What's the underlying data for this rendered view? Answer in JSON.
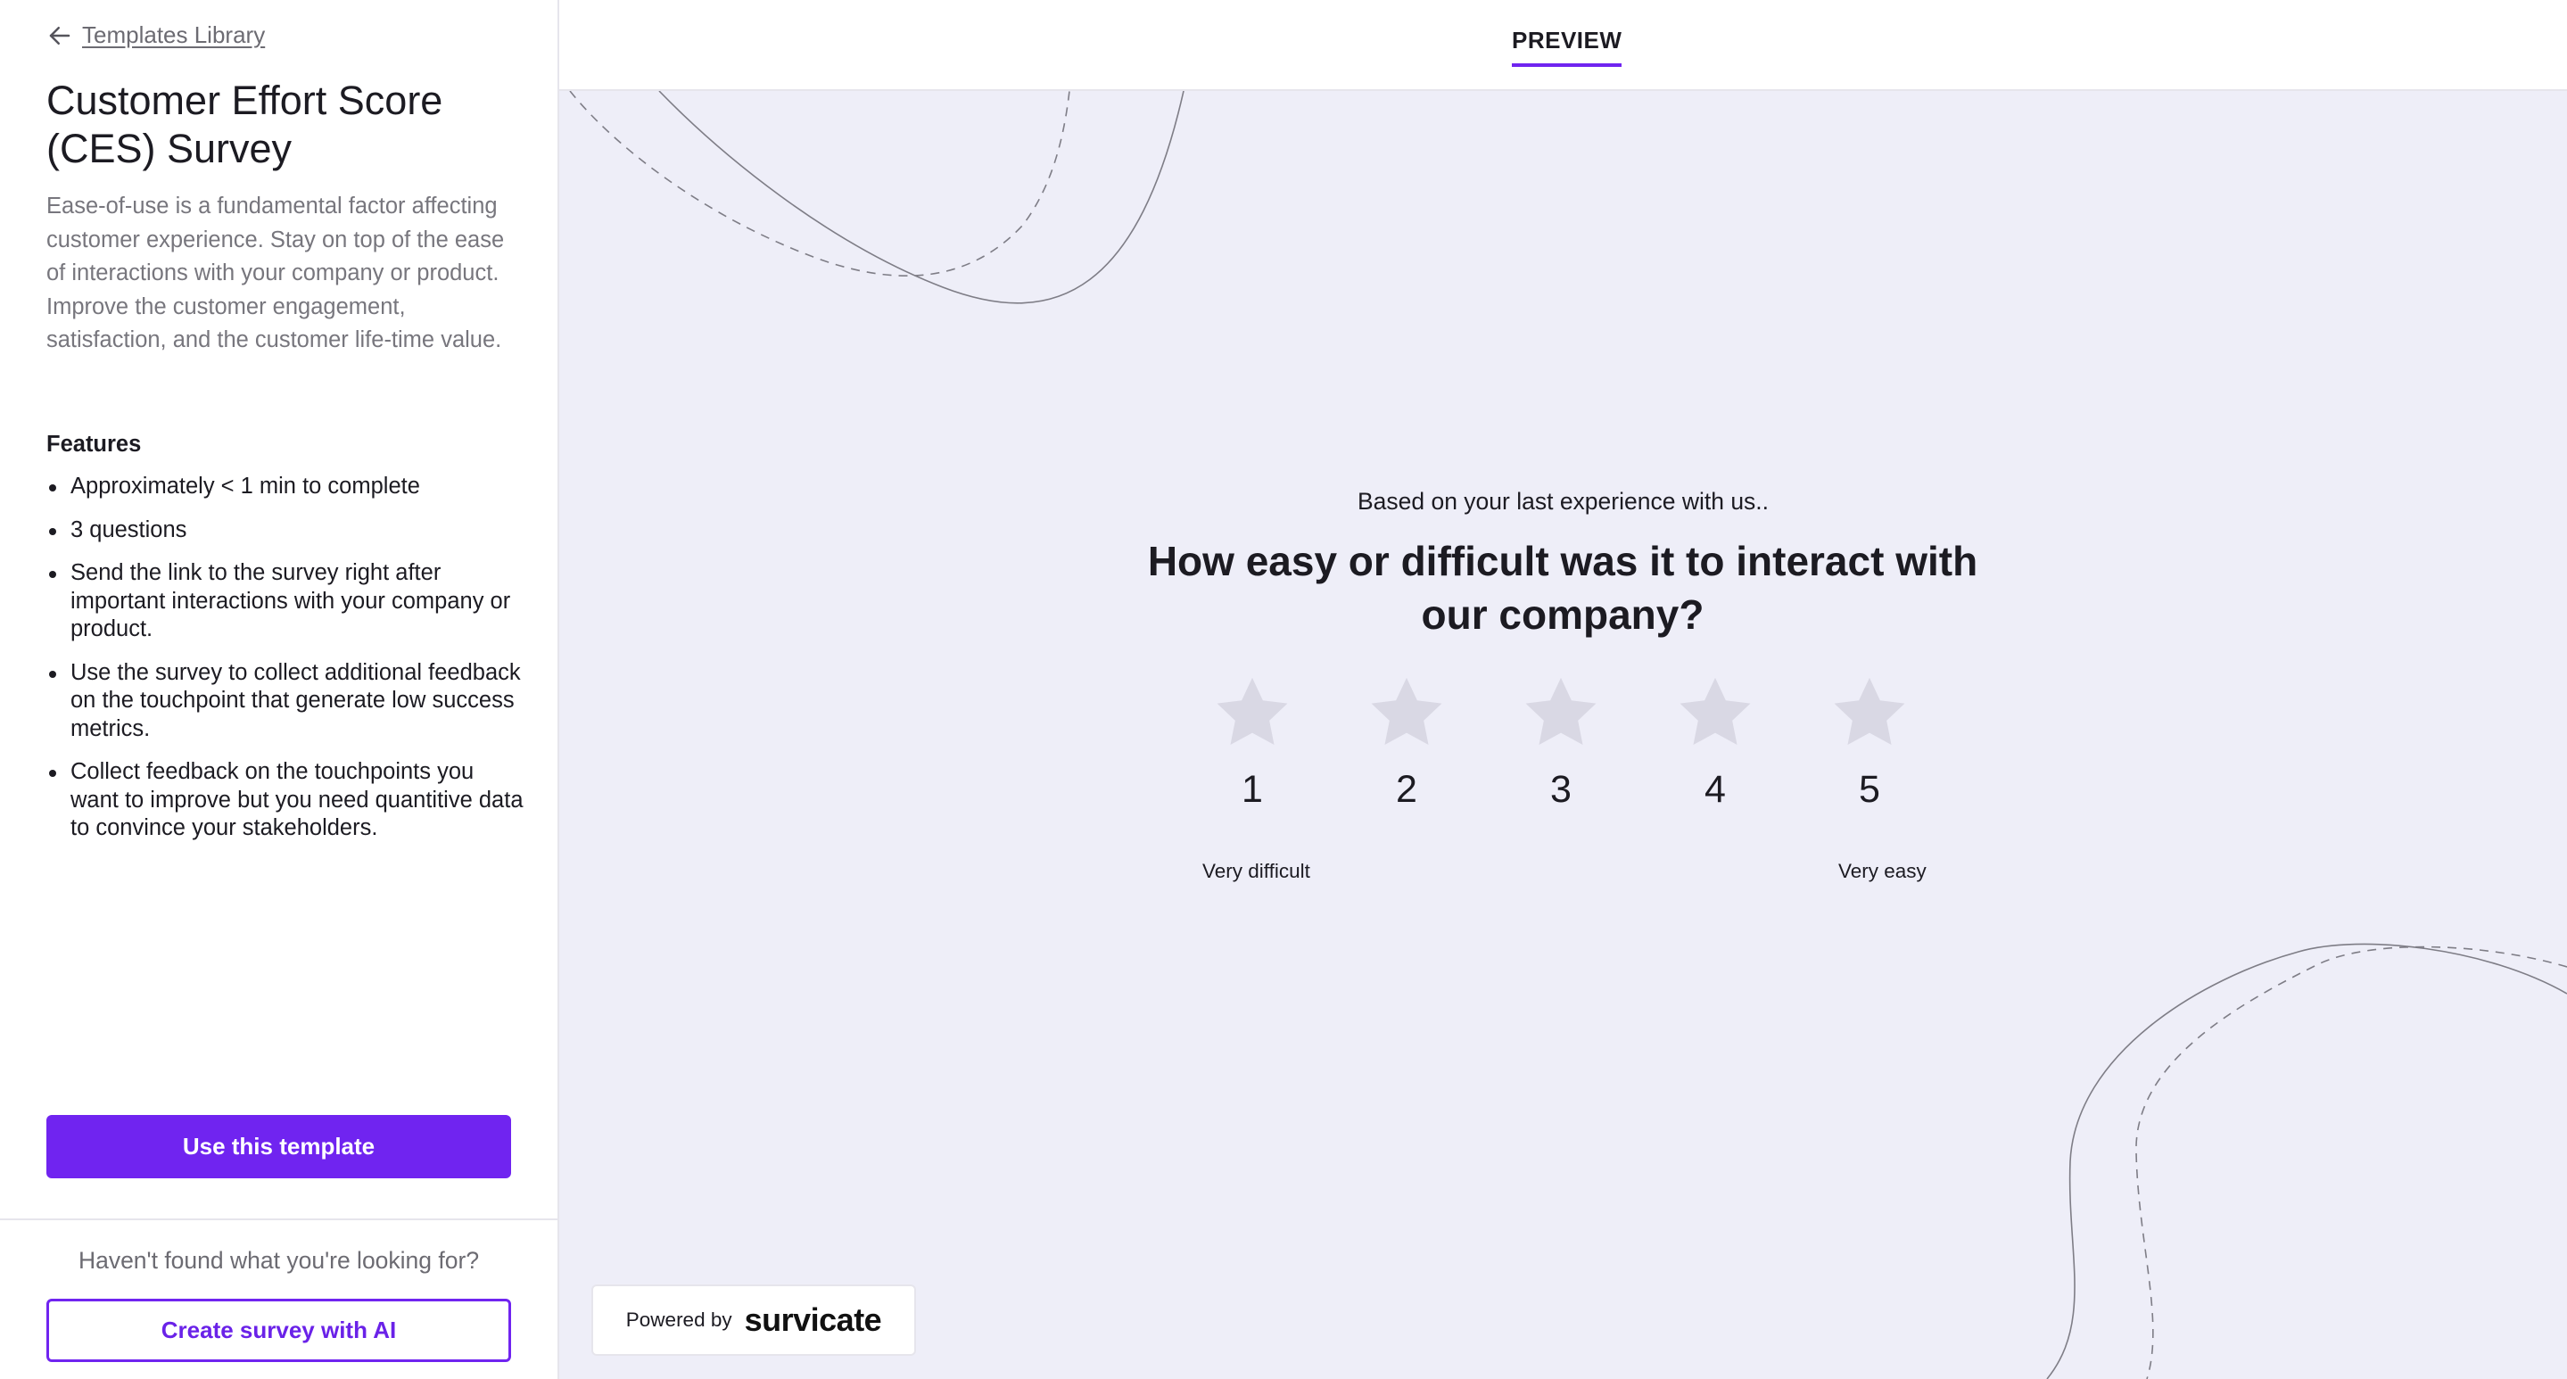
{
  "sidebar": {
    "back_link": "Templates Library",
    "title": "Customer Effort Score (CES) Survey",
    "description": "Ease-of-use is a fundamental factor affecting customer experience. Stay on top of the ease of interactions with your company or product. Improve the customer engagement, satisfaction, and the customer life-time value.",
    "features_heading": "Features",
    "features": [
      "Approximately < 1 min to complete",
      "3 questions",
      "Send the link to the survey right after important interactions with your company or product.",
      "Use the survey to collect additional feedback on the touchpoint that generate low success metrics.",
      "Collect feedback on the touchpoints you want to improve but you need quantitive data to convince your stakeholders."
    ],
    "use_template_button": "Use this template",
    "footer_text": "Haven't found what you're looking for?",
    "create_ai_button": "Create survey with AI"
  },
  "header": {
    "tab": "PREVIEW"
  },
  "survey": {
    "intro": "Based on your last experience with us..",
    "question": "How easy or difficult was it to interact with our company?",
    "ratings": [
      "1",
      "2",
      "3",
      "4",
      "5"
    ],
    "low_label": "Very difficult",
    "high_label": "Very easy"
  },
  "powered": {
    "prefix": "Powered by",
    "brand": "survicate"
  },
  "colors": {
    "accent": "#7024f0",
    "canvas_bg": "#eeeef8",
    "star": "#d9d8e4"
  },
  "icons": {
    "back": "arrow-left-icon",
    "rating": "star-icon"
  }
}
